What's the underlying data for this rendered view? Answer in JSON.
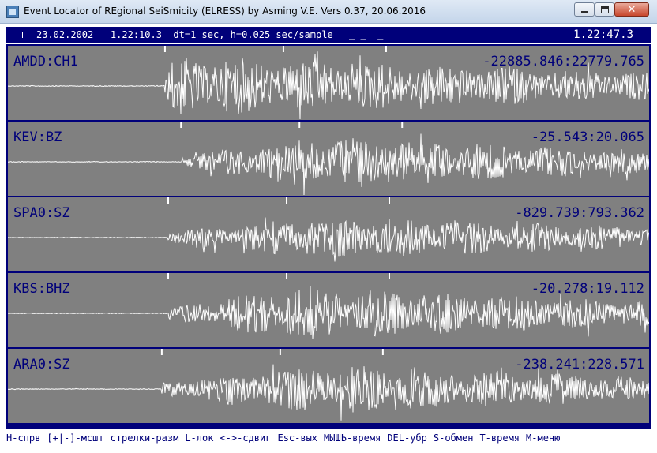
{
  "window": {
    "title": "Event Locator of REgional SeiSmicity (ELRESS) by Asming V.E. Vers 0.37, 20.06.2016"
  },
  "header": {
    "info": "23.02.2002   1.22:10.3  dt=1 sec, h=0.025 sec/sample",
    "underscores": "_ _  _",
    "clock": "1.22:47.3"
  },
  "channels": [
    {
      "name": "AMDD:CH1",
      "range": "-22885.846:22779.765",
      "onset": 0.245,
      "peak": 0.26,
      "amp": 0.95
    },
    {
      "name": "KEV:BZ",
      "range": "-25.543:20.065",
      "onset": 0.27,
      "peak": 0.47,
      "amp": 0.8
    },
    {
      "name": "SPA0:SZ",
      "range": "-829.739:793.362",
      "onset": 0.25,
      "peak": 0.5,
      "amp": 0.7
    },
    {
      "name": "KBS:BHZ",
      "range": "-20.278:19.112",
      "onset": 0.25,
      "peak": 0.43,
      "amp": 0.85
    },
    {
      "name": "ARA0:SZ",
      "range": "-238.241:228.571",
      "onset": 0.24,
      "peak": 0.49,
      "amp": 0.8
    }
  ],
  "footer": {
    "items": [
      "H-спрв",
      "[+|-]-мсшт",
      "стрелки-разм",
      "L-лок",
      "<->-сдвиг",
      "Esc-вых",
      "МЫШЬ-время",
      "DEL-убр",
      "S-обмен",
      "T-время",
      "M-меню"
    ]
  },
  "colors": {
    "frame": "#00007a",
    "trace_bg": "#808080",
    "trace": "#ffffff"
  },
  "icons": {
    "app": "seismograph-app-icon",
    "minimize": "minimize-icon",
    "maximize": "maximize-icon",
    "close": "close-icon"
  }
}
